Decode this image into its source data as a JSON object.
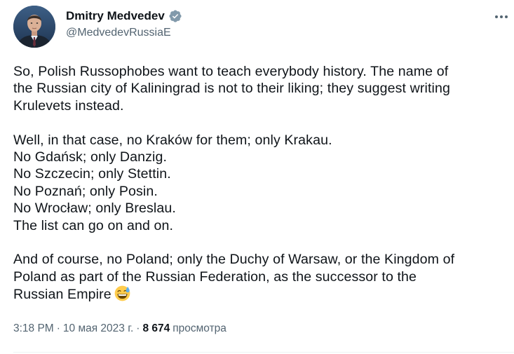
{
  "author": {
    "display_name": "Dmitry Medvedev",
    "handle": "@MedvedevRussiaE",
    "verified": true
  },
  "tweet": {
    "lines": [
      "So, Polish Russophobes want to teach everybody history. The name of",
      "the Russian city of Kaliningrad is not to their liking; they suggest writing",
      "Krulevets instead.",
      "",
      "Well, in that case, no Kraków for them; only Krakau.",
      "No Gdańsk; only Danzig.",
      "No Szczecin; only Stettin.",
      "No Poznań; only Posin.",
      "No Wrocław; only Breslau.",
      "The list can go on and on.",
      "",
      "And of course, no Poland; only the Duchy of Warsaw, or the Kingdom of",
      "Poland as part of the Russian Federation, as the successor to the",
      "Russian Empire"
    ],
    "trailing_emoji": "sweat-smile-emoji"
  },
  "meta": {
    "time": "3:18 PM",
    "separator": "·",
    "date": "10 мая 2023 г.",
    "views_count": "8 674",
    "views_label": "просмотра"
  },
  "icons": {
    "verified": "verified-badge-icon",
    "more": "more-options-icon"
  },
  "colors": {
    "verified_blue": "#1d9bf0",
    "secondary_text": "#536471",
    "primary_text": "#0f1419",
    "divider": "#eff3f4"
  }
}
